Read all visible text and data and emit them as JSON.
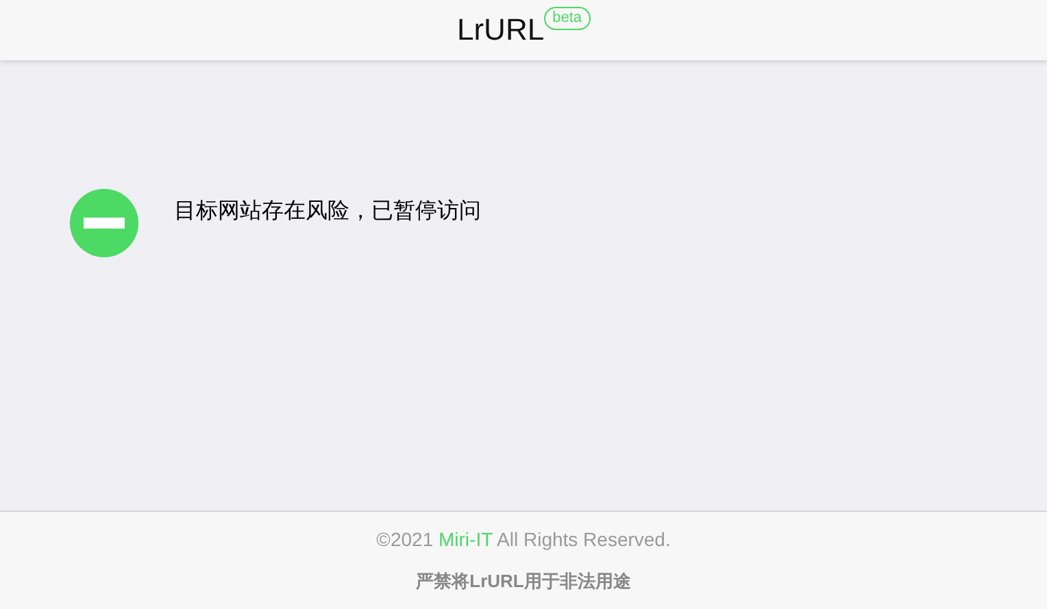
{
  "header": {
    "title": "LrURL",
    "badge": "beta"
  },
  "message": {
    "text": "目标网站存在风险，已暂停访问"
  },
  "footer": {
    "copyright_prefix": "©2021",
    "company_link": "Miri-IT",
    "copyright_suffix": "All Rights Reserved.",
    "notice": "严禁将LrURL用于非法用途"
  }
}
